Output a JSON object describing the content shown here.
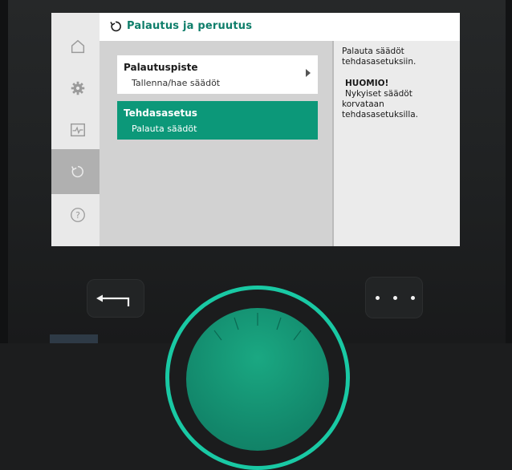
{
  "header": {
    "title": "Palautus ja peruutus"
  },
  "sidebar": {
    "items": [
      {
        "name": "home-icon",
        "active": false
      },
      {
        "name": "gear-icon",
        "active": false
      },
      {
        "name": "pulse-monitor-icon",
        "active": false
      },
      {
        "name": "restore-icon",
        "active": true
      },
      {
        "name": "help-icon",
        "active": false
      }
    ]
  },
  "menu": {
    "items": [
      {
        "label": "Palautuspiste",
        "sublabel": "Tallenna/hae säädöt",
        "selected": false
      },
      {
        "label": "Tehdasasetus",
        "sublabel": "Palauta säädöt",
        "selected": true
      }
    ]
  },
  "info": {
    "line1": "Palauta säädöt",
    "line2": "tehdasasetuksiin.",
    "warning_title": "HUOMIO!",
    "warning_line1": "Nykyiset säädöt",
    "warning_line2": "korvataan",
    "warning_line3": "tehdasasetuksilla."
  },
  "colors": {
    "accent": "#0c9879",
    "title": "#0f7e6a",
    "knob_ring": "#19c9a4"
  }
}
